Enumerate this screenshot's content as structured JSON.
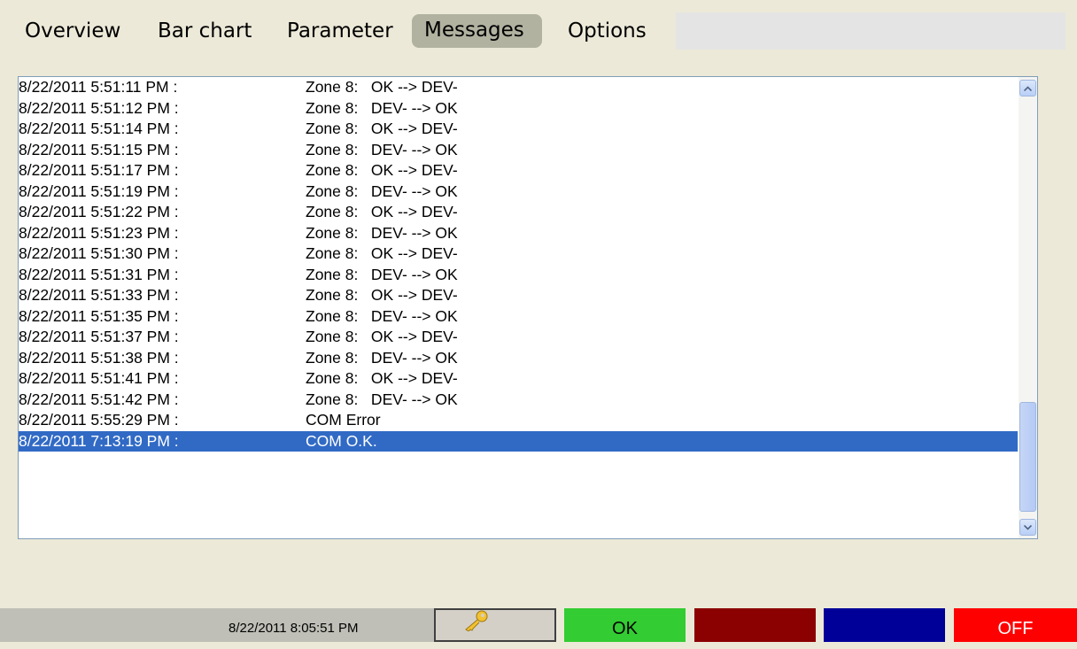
{
  "tabs": [
    {
      "label": "Overview",
      "active": false
    },
    {
      "label": "Bar chart",
      "active": false
    },
    {
      "label": "Parameter",
      "active": false
    },
    {
      "label": "Messages",
      "active": true
    },
    {
      "label": "Options",
      "active": false
    }
  ],
  "messages": [
    {
      "time": "8/22/2011 5:51:11 PM :",
      "text": "Zone 8:   OK --> DEV-"
    },
    {
      "time": "8/22/2011 5:51:12 PM :",
      "text": "Zone 8:   DEV- --> OK"
    },
    {
      "time": "8/22/2011 5:51:14 PM :",
      "text": "Zone 8:   OK --> DEV-"
    },
    {
      "time": "8/22/2011 5:51:15 PM :",
      "text": "Zone 8:   DEV- --> OK"
    },
    {
      "time": "8/22/2011 5:51:17 PM :",
      "text": "Zone 8:   OK --> DEV-"
    },
    {
      "time": "8/22/2011 5:51:19 PM :",
      "text": "Zone 8:   DEV- --> OK"
    },
    {
      "time": "8/22/2011 5:51:22 PM :",
      "text": "Zone 8:   OK --> DEV-"
    },
    {
      "time": "8/22/2011 5:51:23 PM :",
      "text": "Zone 8:   DEV- --> OK"
    },
    {
      "time": "8/22/2011 5:51:30 PM :",
      "text": "Zone 8:   OK --> DEV-"
    },
    {
      "time": "8/22/2011 5:51:31 PM :",
      "text": "Zone 8:   DEV- --> OK"
    },
    {
      "time": "8/22/2011 5:51:33 PM :",
      "text": "Zone 8:   OK --> DEV-"
    },
    {
      "time": "8/22/2011 5:51:35 PM :",
      "text": "Zone 8:   DEV- --> OK"
    },
    {
      "time": "8/22/2011 5:51:37 PM :",
      "text": "Zone 8:   OK --> DEV-"
    },
    {
      "time": "8/22/2011 5:51:38 PM :",
      "text": "Zone 8:   DEV- --> OK"
    },
    {
      "time": "8/22/2011 5:51:41 PM :",
      "text": "Zone 8:   OK --> DEV-"
    },
    {
      "time": "8/22/2011 5:51:42 PM :",
      "text": "Zone 8:   DEV- --> OK"
    },
    {
      "time": "8/22/2011 5:55:29 PM :",
      "text": "COM Error"
    },
    {
      "time": "8/22/2011 7:13:19 PM :",
      "text": "COM O.K.",
      "selected": true
    }
  ],
  "status": {
    "clock": "8/22/2011 8:05:51 PM",
    "key_icon": "key-icon",
    "ok_label": "OK",
    "off_label": "OFF"
  },
  "colors": {
    "background": "#ece9d8",
    "selection": "#316ac5",
    "ok_button": "#33cc33",
    "dark_red_button": "#8b0000",
    "blue_button": "#000099",
    "off_button": "#ff0000"
  }
}
